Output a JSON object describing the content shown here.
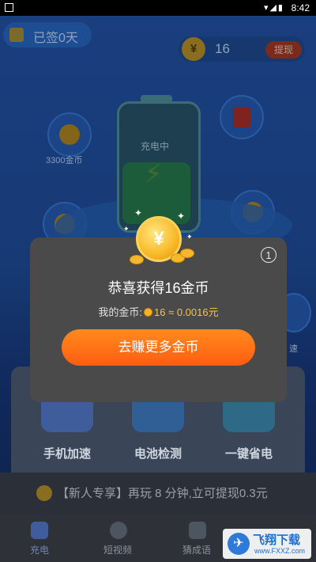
{
  "status_bar": {
    "time": "8:42",
    "icons": "▾◢▮"
  },
  "header": {
    "sign_label": "已签0天",
    "coin_icon": "¥",
    "coin_count": "16",
    "withdraw_label": "提现"
  },
  "bubbles": {
    "left_label": "3300金币",
    "right_label": "速"
  },
  "battery": {
    "label": "充电中"
  },
  "cards": [
    {
      "label": "手机加速"
    },
    {
      "label": "电池检测"
    },
    {
      "label": "一键省电"
    }
  ],
  "banner": {
    "text": "【新人专享】再玩 8 分钟,立可提现0.3元"
  },
  "tabs": [
    {
      "label": "充电"
    },
    {
      "label": "短视频"
    },
    {
      "label": "猜成语"
    }
  ],
  "modal": {
    "countdown": "1",
    "title": "恭喜获得16金币",
    "coins_prefix": "我的金币:",
    "coins_value": "16 ≈ 0.0016元",
    "cta_label": "去赚更多金币",
    "coin_symbol": "¥"
  },
  "watermark": {
    "brand": "飞翔下载",
    "url": "www.FXXZ.com",
    "logo": "✈"
  },
  "colors": {
    "accent": "#ff6a14",
    "gold": "#f7c43f",
    "modal_bg": "#4a4a4a"
  }
}
